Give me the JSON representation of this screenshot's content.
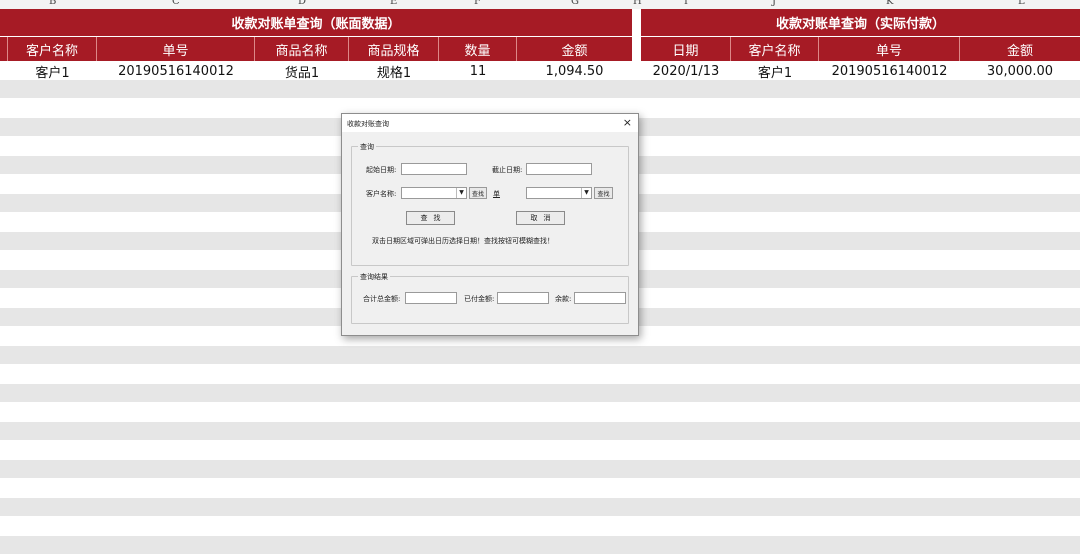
{
  "column_letters": [
    "B",
    "C",
    "D",
    "E",
    "F",
    "G",
    "H",
    "I",
    "J",
    "K",
    "L"
  ],
  "table_left": {
    "title": "收款对账单查询（账面数据）",
    "headers": [
      "客户名称",
      "单号",
      "商品名称",
      "商品规格",
      "数量",
      "金额"
    ],
    "rows": [
      [
        "客户1",
        "20190516140012",
        "货品1",
        "规格1",
        "11",
        "1,094.50"
      ]
    ]
  },
  "table_right": {
    "title": "收款对账单查询（实际付款）",
    "headers": [
      "日期",
      "客户名称",
      "单号",
      "金额"
    ],
    "rows": [
      [
        "2020/1/13",
        "客户1",
        "20190516140012",
        "30,000.00"
      ]
    ]
  },
  "dialog": {
    "title": "收款对账查询",
    "close": "×",
    "query_group": {
      "label": "查询",
      "start_date_label": "起始日期:",
      "start_date_value": "",
      "end_date_label": "截止日期:",
      "end_date_value": "",
      "customer_label": "客户名称:",
      "customer_value": "",
      "find_label": "查找",
      "order_label": "单",
      "order_value": "",
      "find2_label": "查找",
      "search_button": "查找",
      "cancel_button": "取消",
      "hint": "双击日期区域可弹出日历选择日期！查找按钮可模糊查找！"
    },
    "result_group": {
      "label": "查询结果",
      "total_label": "合计总金额:",
      "total_value": "",
      "paid_label": "已付金额:",
      "paid_value": "",
      "balance_label": "余款:",
      "balance_value": ""
    }
  },
  "colors": {
    "header_red": "#a61b25",
    "stripe_gray": "#e6e6e6"
  }
}
